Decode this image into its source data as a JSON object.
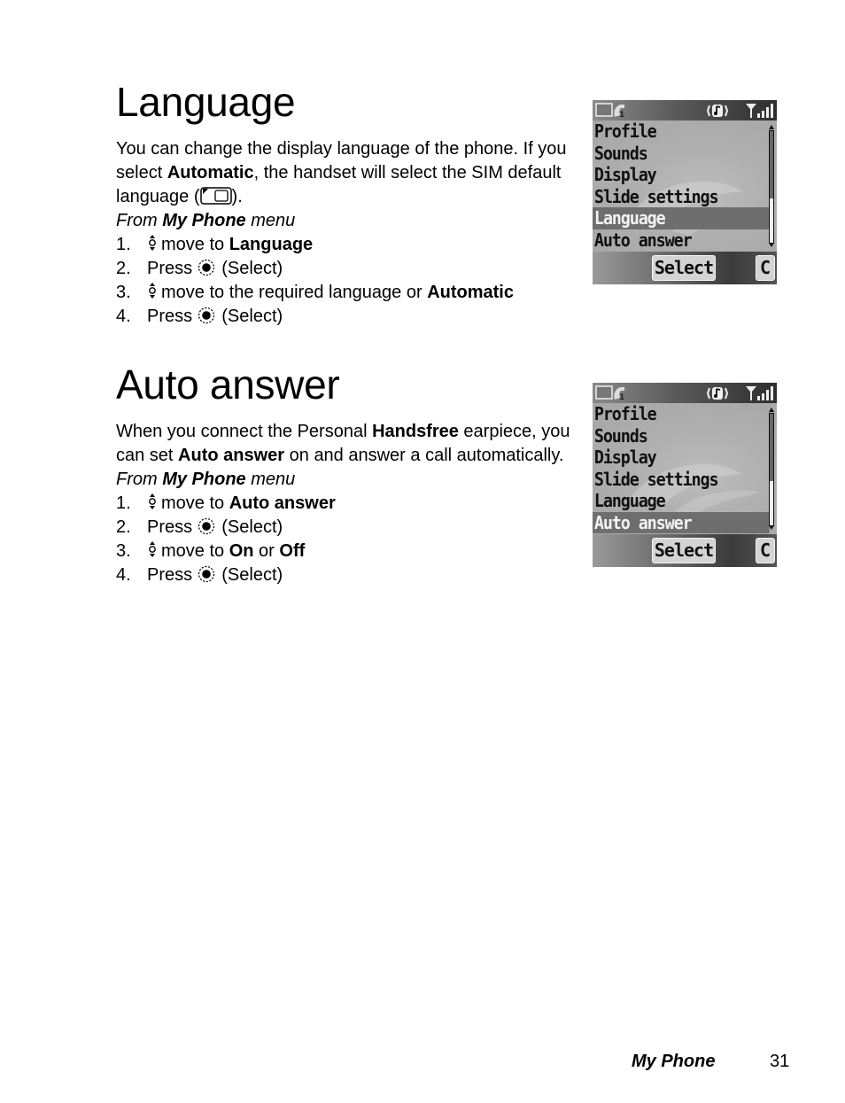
{
  "sections": [
    {
      "title": "Language",
      "intro": [
        {
          "text": "You can change the display language of the phone. If you select ",
          "bold": false
        },
        {
          "text": "Automatic",
          "bold": true
        },
        {
          "text": ", the handset will select the SIM default language (",
          "bold": false
        },
        {
          "icon": "sim-card-icon"
        },
        {
          "text": ").",
          "bold": false
        }
      ],
      "from": {
        "prefix": "From ",
        "menu": "My Phone",
        "suffix": " menu"
      },
      "steps": [
        {
          "num": "1.",
          "icon": "nav-key-icon",
          "parts": [
            {
              "text": "move to ",
              "bold": false
            },
            {
              "text": "Language",
              "bold": true
            }
          ]
        },
        {
          "num": "2.",
          "icon": "select-key-icon",
          "pre": "Press ",
          "parts": [
            {
              "text": "(Select)",
              "bold": false
            }
          ]
        },
        {
          "num": "3.",
          "icon": "nav-key-icon",
          "parts": [
            {
              "text": "move to the required language or ",
              "bold": false
            },
            {
              "text": "Automatic",
              "bold": true
            }
          ]
        },
        {
          "num": "4.",
          "icon": "select-key-icon",
          "pre": "Press ",
          "parts": [
            {
              "text": "(Select)",
              "bold": false
            }
          ]
        }
      ],
      "screen": {
        "status_icons": [
          "battery-icon",
          "line-1-icon",
          "ringer-vibrate-icon",
          "signal-strength-icon"
        ],
        "menu_items": [
          "Profile",
          "Sounds",
          "Display",
          "Slide settings",
          "Language",
          "Auto answer"
        ],
        "selected_index": 4,
        "scroll_position": 0.6,
        "softkey_select": "Select",
        "softkey_clear": "C"
      }
    },
    {
      "title": "Auto answer",
      "intro": [
        {
          "text": "When you connect the Personal ",
          "bold": false
        },
        {
          "text": "Handsfree",
          "bold": true
        },
        {
          "text": " earpiece, you can set ",
          "bold": false
        },
        {
          "text": "Auto answer",
          "bold": true
        },
        {
          "text": " on and answer a call automatically.",
          "bold": false
        }
      ],
      "from": {
        "prefix": "From ",
        "menu": "My Phone",
        "suffix": " menu"
      },
      "steps": [
        {
          "num": "1.",
          "icon": "nav-key-icon",
          "parts": [
            {
              "text": "move to ",
              "bold": false
            },
            {
              "text": "Auto answer",
              "bold": true
            }
          ]
        },
        {
          "num": "2.",
          "icon": "select-key-icon",
          "pre": "Press ",
          "parts": [
            {
              "text": "(Select)",
              "bold": false
            }
          ]
        },
        {
          "num": "3.",
          "icon": "nav-key-icon",
          "parts": [
            {
              "text": "move to ",
              "bold": false
            },
            {
              "text": "On",
              "bold": true
            },
            {
              "text": " or ",
              "bold": false
            },
            {
              "text": "Off",
              "bold": true
            }
          ]
        },
        {
          "num": "4.",
          "icon": "select-key-icon",
          "pre": "Press ",
          "parts": [
            {
              "text": "(Select)",
              "bold": false
            }
          ]
        }
      ],
      "screen": {
        "status_icons": [
          "battery-icon",
          "line-1-icon",
          "ringer-vibrate-icon",
          "signal-strength-icon"
        ],
        "menu_items": [
          "Profile",
          "Sounds",
          "Display",
          "Slide settings",
          "Language",
          "Auto answer"
        ],
        "selected_index": 5,
        "scroll_position": 0.6,
        "softkey_select": "Select",
        "softkey_clear": "C"
      }
    }
  ],
  "footer": {
    "section_title": "My Phone",
    "page_number": "31"
  }
}
